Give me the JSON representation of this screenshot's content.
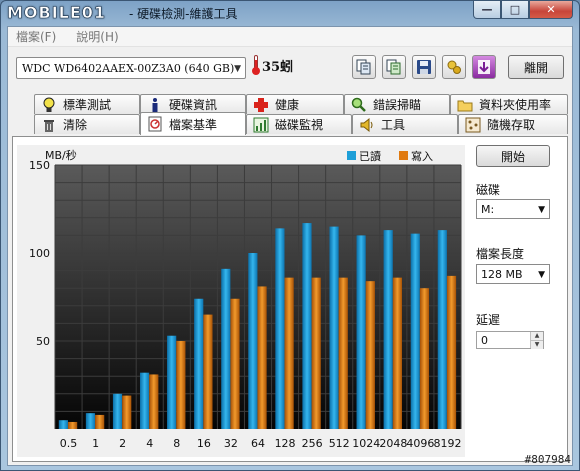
{
  "window": {
    "logo_text": "MOBILE01",
    "title": "- 硬碟檢測-維護工具",
    "minimize": "—",
    "maximize": "□",
    "close": "✕"
  },
  "menu": [
    "檔案(F)",
    "說明(H)"
  ],
  "toolbar": {
    "drive": "WDC WD6402AAEX-00Z3A0 (640 GB)",
    "temperature": "35蚓",
    "exit_label": "離開",
    "icons": [
      "copy-icon",
      "copy-text-icon",
      "save-icon",
      "options-icon",
      "down-arrow-icon"
    ]
  },
  "tabs": {
    "row1": [
      {
        "label": "標準測試",
        "icon": "bulb-icon"
      },
      {
        "label": "硬碟資訊",
        "icon": "info-icon"
      },
      {
        "label": "健康",
        "icon": "health-cross-icon"
      },
      {
        "label": "錯誤掃瞄",
        "icon": "magnifier-icon"
      },
      {
        "label": "資料夾使用率",
        "icon": "folder-icon"
      }
    ],
    "row2": [
      {
        "label": "清除",
        "icon": "trash-icon"
      },
      {
        "label": "檔案基準",
        "icon": "file-benchmark-icon",
        "active": true
      },
      {
        "label": "磁碟監視",
        "icon": "monitor-icon"
      },
      {
        "label": "工具",
        "icon": "speaker-icon"
      },
      {
        "label": "隨機存取",
        "icon": "random-access-icon"
      }
    ]
  },
  "controls": {
    "start_label": "開始",
    "disk_label": "磁碟",
    "disk_value": "M:",
    "file_length_label": "檔案長度",
    "file_length_value": "128 MB",
    "delay_label": "延遲",
    "delay_value": "0"
  },
  "chart_data": {
    "type": "bar",
    "ylabel": "MB/秒",
    "ylim": [
      0,
      150
    ],
    "yticks": [
      50,
      100,
      150
    ],
    "categories": [
      "0.5",
      "1",
      "2",
      "4",
      "8",
      "16",
      "32",
      "64",
      "128",
      "256",
      "512",
      "1024",
      "2048",
      "4096",
      "8192"
    ],
    "series": [
      {
        "name": "已讀",
        "color": "#1e9fd8",
        "values": [
          5,
          9,
          20,
          32,
          53,
          74,
          91,
          100,
          114,
          117,
          115,
          110,
          113,
          111,
          113
        ]
      },
      {
        "name": "寫入",
        "color": "#e07a10",
        "values": [
          4,
          8,
          19,
          31,
          50,
          65,
          74,
          81,
          86,
          86,
          86,
          84,
          86,
          80,
          87
        ]
      }
    ],
    "legend_position": "top-right",
    "grid": true
  },
  "watermark": "#807984"
}
